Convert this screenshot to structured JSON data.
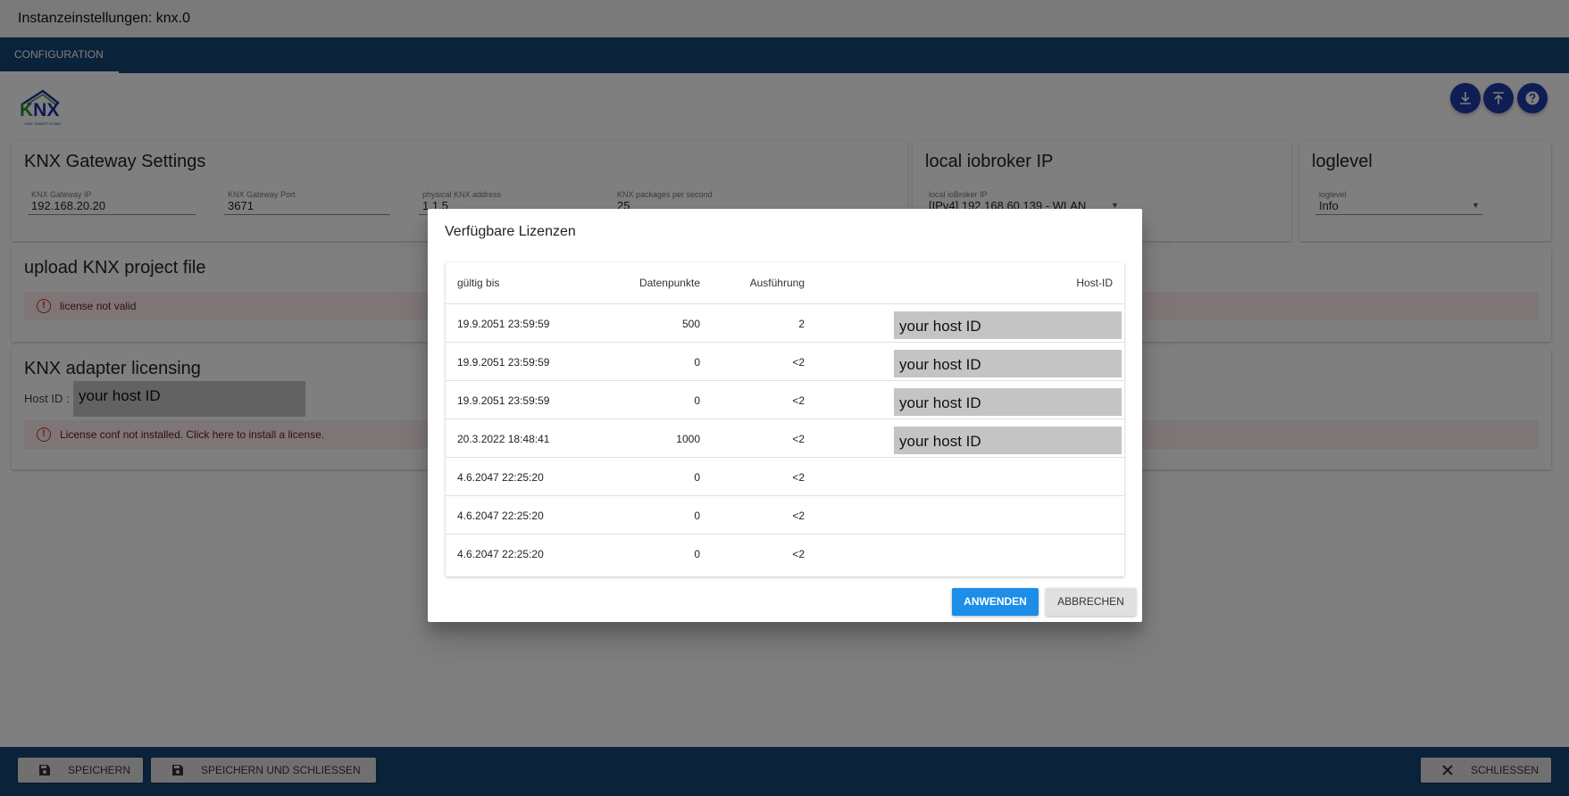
{
  "window": {
    "title": "Instanzeinstellungen: knx.0"
  },
  "tabs": [
    {
      "label": "CONFIGURATION",
      "active": true
    }
  ],
  "header_icons": [
    "download-icon",
    "upload-icon",
    "help-icon"
  ],
  "logo": {
    "text_k": "K",
    "text_nx": "NX",
    "subtitle": "KNX SMART HOME"
  },
  "gateway": {
    "title": "KNX Gateway Settings",
    "fields": [
      {
        "label": "KNX Gateway IP",
        "value": "192.168.20.20"
      },
      {
        "label": "KNX Gateway Port",
        "value": "3671"
      },
      {
        "label": "physical KNX address",
        "value": "1.1.5"
      },
      {
        "label": "KNX packages per second",
        "value": "25"
      }
    ]
  },
  "local_ip": {
    "title": "local iobroker IP",
    "field": {
      "label": "local ioBroker IP",
      "value": "[IPv4] 192.168.60.139 - WLAN"
    }
  },
  "loglevel": {
    "title": "loglevel",
    "field": {
      "label": "loglevel",
      "value": "Info"
    }
  },
  "upload": {
    "title": "upload KNX project file",
    "alert": "license not valid"
  },
  "licensing": {
    "title": "KNX adapter licensing",
    "hostid_label": "Host ID :",
    "hostid_value": "your host ID",
    "alert": "License conf not installed. Click here to install a license."
  },
  "dialog": {
    "title": "Verfügbare Lizenzen",
    "columns": {
      "valid_until": "gültig bis",
      "datapoints": "Datenpunkte",
      "execution": "Ausführung",
      "host_id": "Host-ID"
    },
    "rows": [
      {
        "valid_until": "19.9.2051 23:59:59",
        "datapoints": "500",
        "execution": "2",
        "host_id": "your host ID"
      },
      {
        "valid_until": "19.9.2051 23:59:59",
        "datapoints": "0",
        "execution": "<2",
        "host_id": "your host ID"
      },
      {
        "valid_until": "19.9.2051 23:59:59",
        "datapoints": "0",
        "execution": "<2",
        "host_id": "your host ID"
      },
      {
        "valid_until": "20.3.2022 18:48:41",
        "datapoints": "1000",
        "execution": "<2",
        "host_id": "your host ID"
      },
      {
        "valid_until": "4.6.2047 22:25:20",
        "datapoints": "0",
        "execution": "<2",
        "host_id": ""
      },
      {
        "valid_until": "4.6.2047 22:25:20",
        "datapoints": "0",
        "execution": "<2",
        "host_id": ""
      },
      {
        "valid_until": "4.6.2047 22:25:20",
        "datapoints": "0",
        "execution": "<2",
        "host_id": ""
      }
    ],
    "apply_label": "ANWENDEN",
    "cancel_label": "ABBRECHEN"
  },
  "bottom": {
    "save_label": "SPEICHERN",
    "save_close_label": "SPEICHERN UND SCHLIESSEN",
    "close_label": "SCHLIESSEN"
  },
  "colors": {
    "appbar": "#164477",
    "primary_button": "#1c8ee8",
    "round_button": "#1c3aa9",
    "alert_bg": "#fdeded",
    "hostid_bg": "#c4c4c4"
  }
}
